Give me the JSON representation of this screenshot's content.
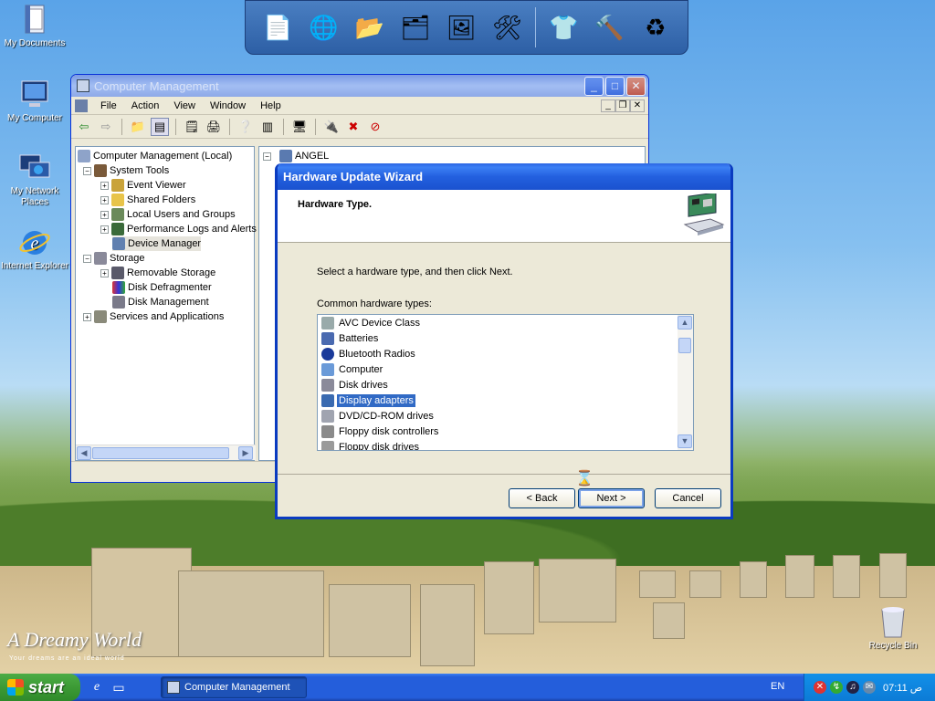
{
  "desktop": {
    "icons": [
      {
        "label": "My Documents",
        "icon": "my-documents-icon"
      },
      {
        "label": "My Computer",
        "icon": "my-computer-icon"
      },
      {
        "label": "My Network Places",
        "icon": "network-places-icon"
      },
      {
        "label": "Internet Explorer",
        "icon": "internet-explorer-icon"
      }
    ],
    "recycle_label": "Recycle Bin",
    "brand": "A Dreamy World",
    "brand_sub": "Your dreams are an  ideal   world"
  },
  "cm_window": {
    "title": "Computer Management",
    "menu": [
      "File",
      "Action",
      "View",
      "Window",
      "Help"
    ],
    "tree": {
      "root": "Computer Management (Local)",
      "system_tools": "System Tools",
      "event_viewer": "Event Viewer",
      "shared_folders": "Shared Folders",
      "local_users": "Local Users and Groups",
      "perf_logs": "Performance Logs and Alerts",
      "device_manager": "Device Manager",
      "storage": "Storage",
      "removable": "Removable Storage",
      "defrag": "Disk Defragmenter",
      "disk_mgmt": "Disk Management",
      "services": "Services and Applications"
    },
    "right_root": "ANGEL"
  },
  "wizard": {
    "title": "Hardware Update Wizard",
    "header": "Hardware Type.",
    "prompt": "Select a hardware type, and then click Next.",
    "list_label": "Common hardware types:",
    "items": [
      "AVC Device Class",
      "Batteries",
      "Bluetooth Radios",
      "Computer",
      "Disk drives",
      "Display adapters",
      "DVD/CD-ROM drives",
      "Floppy disk controllers",
      "Floppy disk drives"
    ],
    "selected_index": 5,
    "back": "< Back",
    "next": "Next >",
    "cancel": "Cancel"
  },
  "taskbar": {
    "start": "start",
    "task": "Computer Management",
    "lang": "EN",
    "clock": "07:11 ص"
  },
  "colors": {
    "selection": "#316ac5",
    "titlebar": "#2360df",
    "start": "#3c9a35"
  }
}
